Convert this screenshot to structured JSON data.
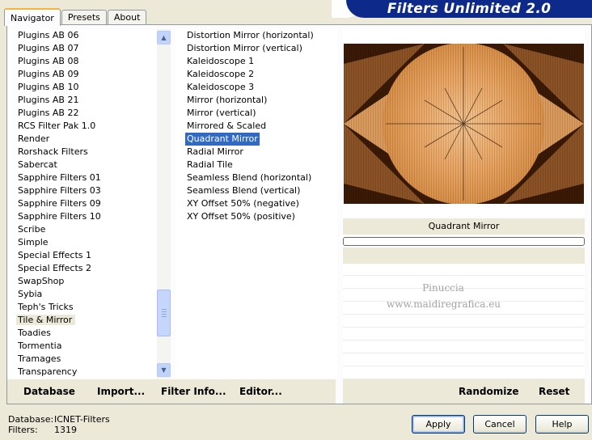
{
  "tabs": [
    {
      "label": "Navigator",
      "active": true
    },
    {
      "label": "Presets",
      "active": false
    },
    {
      "label": "About",
      "active": false
    }
  ],
  "banner": {
    "title": "Filters Unlimited 2.0"
  },
  "categories": [
    "Plugins AB 06",
    "Plugins AB 07",
    "Plugins AB 08",
    "Plugins AB 09",
    "Plugins AB 10",
    "Plugins AB 21",
    "Plugins AB 22",
    "RCS Filter Pak 1.0",
    "Render",
    "Rorshack Filters",
    "Sabercat",
    "Sapphire Filters 01",
    "Sapphire Filters 03",
    "Sapphire Filters 09",
    "Sapphire Filters 10",
    "Scribe",
    "Simple",
    "Special Effects 1",
    "Special Effects 2",
    "SwapShop",
    "Sybia",
    "Teph's Tricks",
    "Tile & Mirror",
    "Toadies",
    "Tormentia",
    "Tramages",
    "Transparency"
  ],
  "selected_category": "Tile & Mirror",
  "filters": [
    "Distortion Mirror (horizontal)",
    "Distortion Mirror (vertical)",
    "Kaleidoscope 1",
    "Kaleidoscope 2",
    "Kaleidoscope 3",
    "Mirror (horizontal)",
    "Mirror (vertical)",
    "Mirrored & Scaled",
    "Quadrant Mirror",
    "Radial Mirror",
    "Radial Tile",
    "Seamless Blend (horizontal)",
    "Seamless Blend (vertical)",
    "XY Offset 50% (negative)",
    "XY Offset 50% (positive)"
  ],
  "selected_filter": "Quadrant Mirror",
  "preview": {
    "filter_name": "Quadrant Mirror",
    "progress_percent": 0
  },
  "watermark": {
    "line1": "Pinuccia",
    "line2": "www.maidiregrafica.eu"
  },
  "bottom_links": {
    "database": "Database",
    "import": "Import...",
    "filter_info": "Filter Info...",
    "editor": "Editor...",
    "randomize": "Randomize",
    "reset": "Reset"
  },
  "status": {
    "database_label": "Database:",
    "database_value": "ICNET-Filters",
    "filters_label": "Filters:",
    "filters_value": "1319"
  },
  "buttons": {
    "apply": "Apply",
    "cancel": "Cancel",
    "help": "Help"
  },
  "colors": {
    "selection": "#316ac5",
    "banner": "#0d2a8a",
    "dialog_bg": "#ece9d8"
  },
  "icons": {
    "scroll_up": "chevron-up-icon",
    "scroll_down": "chevron-down-icon"
  }
}
